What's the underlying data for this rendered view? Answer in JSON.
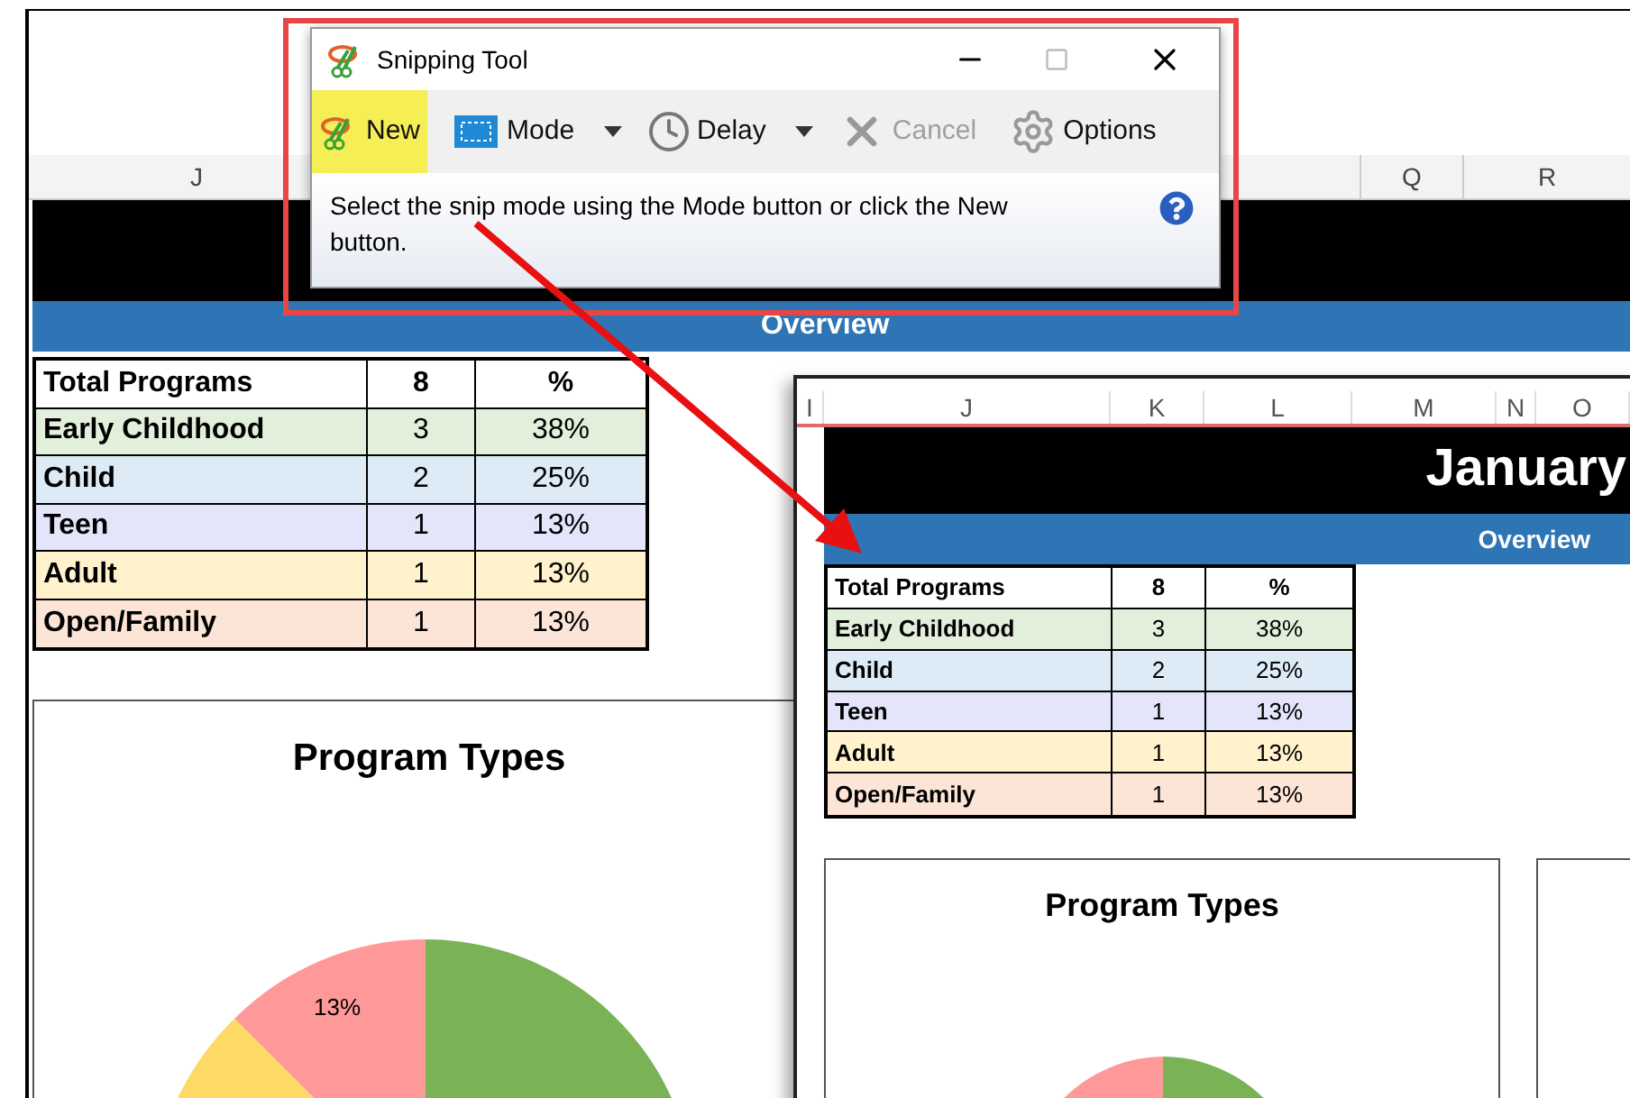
{
  "sheet": {
    "columns": [
      "J",
      "Q",
      "R"
    ],
    "overview": "Overview",
    "table": {
      "header": [
        "Total Programs",
        "8",
        "%"
      ],
      "rows": [
        {
          "label": "Early Childhood",
          "count": "3",
          "percent": "38%",
          "color": "#e2efda"
        },
        {
          "label": "Child",
          "count": "2",
          "percent": "25%",
          "color": "#ddebf7"
        },
        {
          "label": "Teen",
          "count": "1",
          "percent": "13%",
          "color": "#e4e4fb"
        },
        {
          "label": "Adult",
          "count": "1",
          "percent": "13%",
          "color": "#fff2cc"
        },
        {
          "label": "Open/Family",
          "count": "1",
          "percent": "13%",
          "color": "#fce4d6"
        }
      ]
    },
    "chart": {
      "title": "Program Types",
      "slice_label": "13%"
    }
  },
  "snip": {
    "columns": [
      "I",
      "J",
      "K",
      "L",
      "M",
      "N",
      "O"
    ],
    "title": "January",
    "overview": "Overview",
    "table": {
      "header": [
        "Total Programs",
        "8",
        "%"
      ],
      "rows": [
        {
          "label": "Early Childhood",
          "count": "3",
          "percent": "38%",
          "color": "#e2efda"
        },
        {
          "label": "Child",
          "count": "2",
          "percent": "25%",
          "color": "#ddebf7"
        },
        {
          "label": "Teen",
          "count": "1",
          "percent": "13%",
          "color": "#e4e4fb"
        },
        {
          "label": "Adult",
          "count": "1",
          "percent": "13%",
          "color": "#fff2cc"
        },
        {
          "label": "Open/Family",
          "count": "1",
          "percent": "13%",
          "color": "#fce4d6"
        }
      ]
    },
    "chart": {
      "title": "Program Types"
    }
  },
  "snipping_tool": {
    "title": "Snipping Tool",
    "buttons": [
      {
        "kind": "new",
        "label": "New",
        "selected": true,
        "disabled": false,
        "dropdown": false
      },
      {
        "kind": "mode",
        "label": "Mode",
        "selected": false,
        "disabled": false,
        "dropdown": true
      },
      {
        "kind": "delay",
        "label": "Delay",
        "selected": false,
        "disabled": false,
        "dropdown": true
      },
      {
        "kind": "cancel",
        "label": "Cancel",
        "selected": false,
        "disabled": true,
        "dropdown": false
      },
      {
        "kind": "options",
        "label": "Options",
        "selected": false,
        "disabled": false,
        "dropdown": false
      }
    ],
    "message": "Select the snip mode using the Mode button or click the New button."
  }
}
